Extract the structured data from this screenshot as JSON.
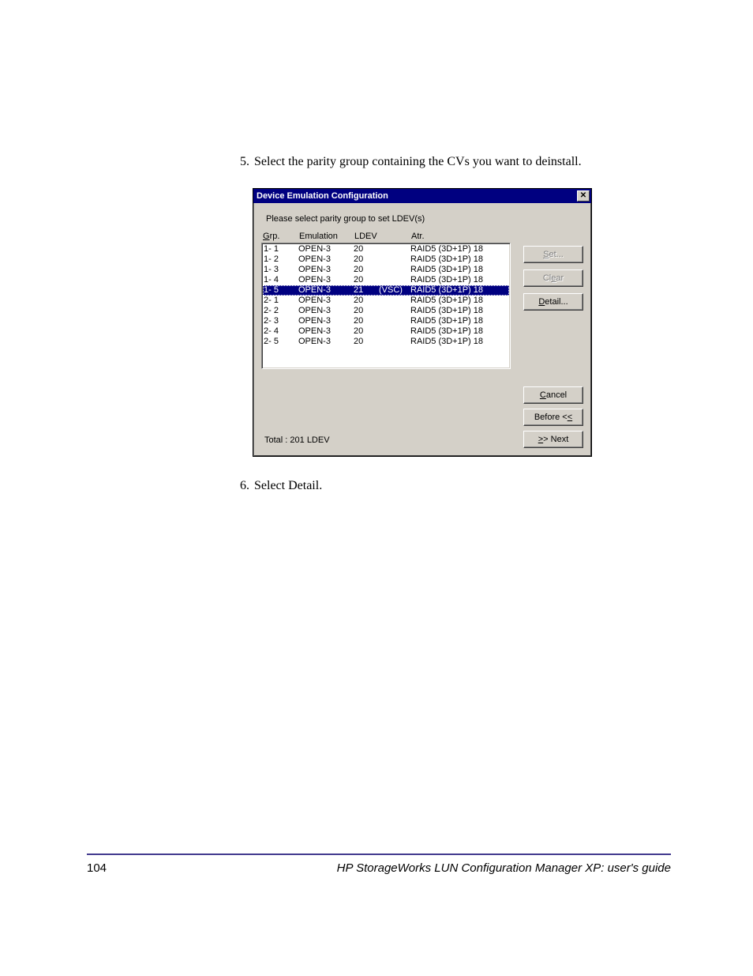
{
  "steps": {
    "s5_num": "5.",
    "s5_text": "Select the parity group containing the CVs you want to deinstall.",
    "s6_num": "6.",
    "s6_text": "Select Detail."
  },
  "dialog": {
    "title": "Device Emulation Configuration",
    "instruction": "Please select parity group to set LDEV(s)",
    "headers": {
      "grp_u": "G",
      "grp_r": "rp.",
      "emu": "Emulation",
      "ldev": "LDEV",
      "atr": "Atr."
    },
    "rows": [
      {
        "grp": "1- 1",
        "emu": "OPEN-3",
        "ldev": "20",
        "flag": "",
        "atr": "RAID5 (3D+1P)  18",
        "sel": false
      },
      {
        "grp": "1- 2",
        "emu": "OPEN-3",
        "ldev": "20",
        "flag": "",
        "atr": "RAID5 (3D+1P)  18",
        "sel": false
      },
      {
        "grp": "1- 3",
        "emu": "OPEN-3",
        "ldev": "20",
        "flag": "",
        "atr": "RAID5 (3D+1P)  18",
        "sel": false
      },
      {
        "grp": "1- 4",
        "emu": "OPEN-3",
        "ldev": "20",
        "flag": "",
        "atr": "RAID5 (3D+1P)  18",
        "sel": false
      },
      {
        "grp": "1- 5",
        "emu": "OPEN-3",
        "ldev": "21",
        "flag": "(VSC)",
        "atr": "RAID5 (3D+1P)  18",
        "sel": true
      },
      {
        "grp": "2- 1",
        "emu": "OPEN-3",
        "ldev": "20",
        "flag": "",
        "atr": "RAID5 (3D+1P)  18",
        "sel": false
      },
      {
        "grp": "2- 2",
        "emu": "OPEN-3",
        "ldev": "20",
        "flag": "",
        "atr": "RAID5 (3D+1P)  18",
        "sel": false
      },
      {
        "grp": "2- 3",
        "emu": "OPEN-3",
        "ldev": "20",
        "flag": "",
        "atr": "RAID5 (3D+1P)  18",
        "sel": false
      },
      {
        "grp": "2- 4",
        "emu": "OPEN-3",
        "ldev": "20",
        "flag": "",
        "atr": "RAID5 (3D+1P)  18",
        "sel": false
      },
      {
        "grp": "2- 5",
        "emu": "OPEN-3",
        "ldev": "20",
        "flag": "",
        "atr": "RAID5 (3D+1P)  18",
        "sel": false
      }
    ],
    "buttons": {
      "set_u": "S",
      "set_r": "et...",
      "clear_pre": "Cl",
      "clear_u": "e",
      "clear_r": "ar",
      "detail_u": "D",
      "detail_r": "etail...",
      "cancel_u": "C",
      "cancel_r": "ancel",
      "before_pre": "Before <",
      "before_u": "<",
      "next_pre": "",
      "next_u": ">",
      "next_r": "> Next"
    },
    "total": "Total : 201 LDEV"
  },
  "footer": {
    "page": "104",
    "title": "HP StorageWorks LUN Configuration Manager XP: user's guide"
  }
}
